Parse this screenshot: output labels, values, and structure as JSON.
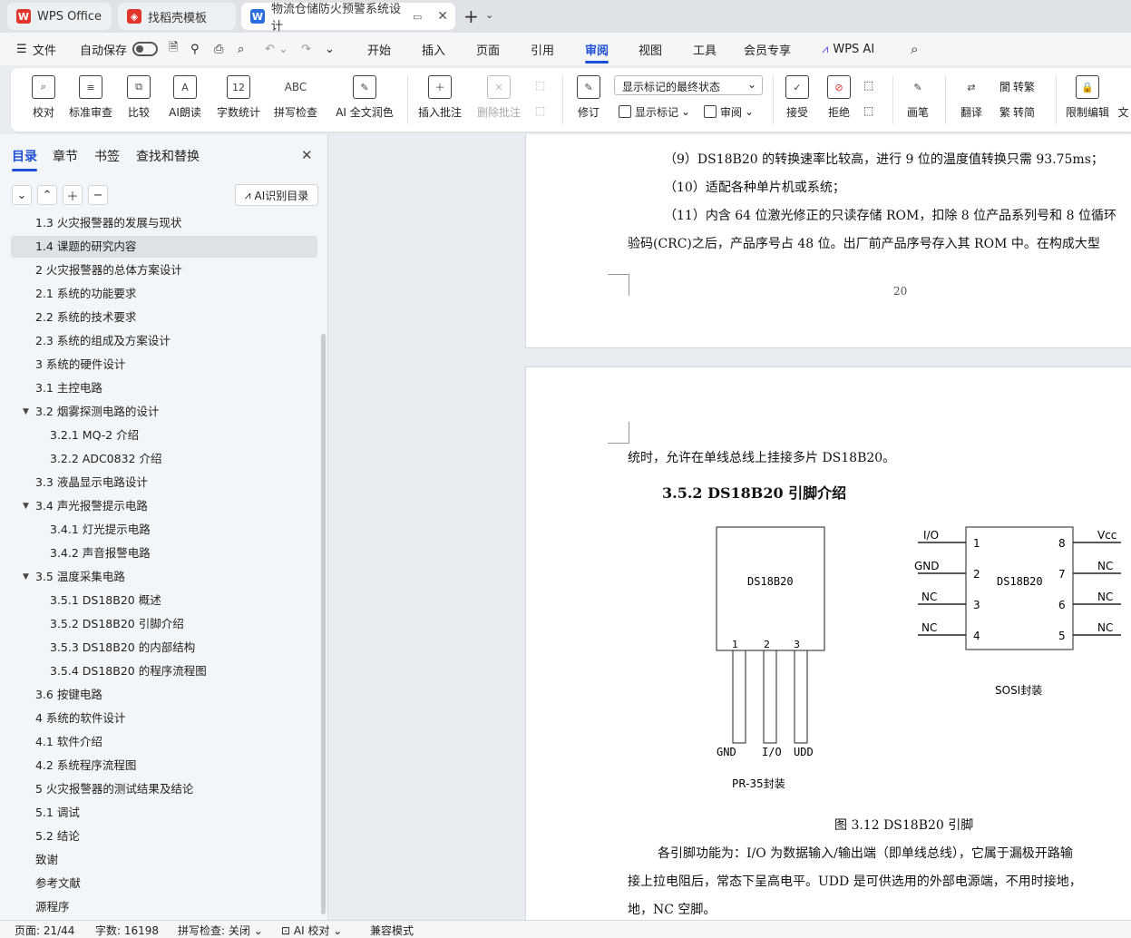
{
  "tabs": [
    {
      "label": "WPS Office"
    },
    {
      "label": "找稻壳模板"
    },
    {
      "label": "物流仓储防火预警系统设计"
    }
  ],
  "menu": {
    "file": "文件",
    "autosave": "自动保存",
    "items": [
      "开始",
      "插入",
      "页面",
      "引用",
      "审阅",
      "视图",
      "工具",
      "会员专享",
      "WPS AI"
    ],
    "active": "审阅"
  },
  "ribbon": {
    "buttons": [
      "校对",
      "标准审查",
      "比较",
      "AI朗读",
      "字数统计",
      "拼写检查",
      "AI 全文润色",
      "插入批注",
      "删除批注",
      "修订",
      "接受",
      "拒绝",
      "画笔",
      "翻译",
      "限制编辑",
      "文"
    ],
    "markup_state": "显示标记的最终状态",
    "show_markup": "显示标记",
    "review": "审阅",
    "convert_trad": "转繁",
    "convert_simp": "转简"
  },
  "sidebar": {
    "tabs": [
      "目录",
      "章节",
      "书签",
      "查找和替换"
    ],
    "ai_button": "AI识别目录",
    "toc": [
      "1.3 火灾报警器的发展与现状",
      "1.4 课题的研究内容",
      "2 火灾报警器的总体方案设计",
      "2.1 系统的功能要求",
      "2.2  系统的技术要求",
      "2.3  系统的组成及方案设计",
      "3  系统的硬件设计",
      "3.1  主控电路",
      "3.2  烟雾探测电路的设计",
      "3.2.1 MQ-2 介绍",
      "3.2.2 ADC0832 介绍",
      "3.3  液晶显示电路设计",
      "3.4  声光报警提示电路",
      "3.4.1  灯光提示电路",
      "3.4.2  声音报警电路",
      "3.5  温度采集电路",
      "3.5.1 DS18B20 概述",
      "3.5.2 DS18B20 引脚介绍",
      "3.5.3 DS18B20 的内部结构",
      "3.5.4 DS18B20 的程序流程图",
      "3.6  按键电路",
      "4  系统的软件设计",
      "4.1  软件介绍",
      "4.2  系统程序流程图",
      "5 火灾报警器的测试结果及结论",
      "5.1  调试",
      "5.2  结论",
      "致谢",
      "参考文献",
      "源程序"
    ]
  },
  "doc": {
    "p1": "（9）DS18B20 的转换速率比较高，进行 9 位的温度值转换只需 93.75ms；",
    "p2": "（10）适配各种单片机或系统；",
    "p3": "（11）内含 64 位激光修正的只读存储 ROM，扣除 8 位产品系列号和 8 位循环",
    "p4": "验码(CRC)之后，产品序号占 48 位。出厂前产品序号存入其 ROM 中。在构成大型",
    "page_num": "20",
    "p5": "统时，允许在单线总线上挂接多片 DS18B20。",
    "heading": "3.5.2 DS18B20 引脚介绍",
    "fig": {
      "chip_label": "DS18B20",
      "to92_pins": [
        "1",
        "2",
        "3"
      ],
      "to92_names": [
        "GND",
        "I/O",
        "UDD"
      ],
      "to92_caption": "PR-35封装",
      "so_chip": "DS18B20",
      "so_left": [
        "I/O",
        "GND",
        "NC",
        "NC"
      ],
      "so_left_nums": [
        "1",
        "2",
        "3",
        "4"
      ],
      "so_right": [
        "Vcc",
        "NC",
        "NC",
        "NC"
      ],
      "so_right_nums": [
        "8",
        "7",
        "6",
        "5"
      ],
      "so_caption": "SOSI封装"
    },
    "caption": "图 3.12 DS18B20 引脚",
    "p6": "各引脚功能为：I/O 为数据输入/输出端（即单线总线），它属于漏极开路输",
    "p7": "接上拉电阻后，常态下呈高电平。UDD 是可供选用的外部电源端，不用时接地，",
    "p8": "地，NC 空脚。"
  },
  "status": {
    "page": "页面: 21/44",
    "words": "字数: 16198",
    "spell": "拼写检查: 关闭",
    "ai": "AI 校对",
    "compat": "兼容模式"
  }
}
